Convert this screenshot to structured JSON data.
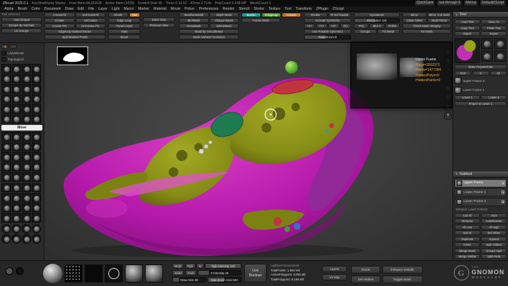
{
  "colors": {
    "teal": "#13a28f",
    "green": "#4a9e2a",
    "orange": "#c4761e",
    "magenta": "#bf1bb3",
    "olive": "#8b9318",
    "value_orange": "#f0a640"
  },
  "titlebar": {
    "app_title": "ZBrush 2025.0.1",
    "stats": [
      "KeyShotHome Master",
      "Free Mem:44,002GB",
      "Active Mem:(1035)",
      "Scratch Disk 45",
      "Timer:0:10.52",
      "ATime 2.714s",
      "PolyCount 6.198 MP",
      "MeshCount 3"
    ],
    "right_items": [
      "QuickSave",
      "see-through 0",
      "Menus",
      "DefaultZScript"
    ]
  },
  "menubar": {
    "items": [
      "Alpha",
      "Brush",
      "Color",
      "Document",
      "Draw",
      "Edit",
      "File",
      "Layer",
      "Light",
      "Macro",
      "Marker",
      "Material",
      "Movie",
      "Picker",
      "Preferences",
      "Render",
      "Stencil",
      "Stroke",
      "Texture",
      "Tool",
      "Transform",
      "ZPlugin",
      "ZScript"
    ]
  },
  "shelf": {
    "status": "Tool selected",
    "groups_col": [
      "Auto Groups",
      "Groups By Normals",
      "Uv Groups"
    ],
    "crease_pairs": [
      [
        "CreaseAll",
        "UnCreaseAll"
      ],
      [
        "Crease",
        "UnCrease"
      ],
      [
        "Crease PG",
        "UnCrease PG"
      ]
    ],
    "crease_wide": [
      "Edgeloop Masked Border",
      "Split Masked Points"
    ],
    "divide_label": "Divide",
    "smt_label": "Smt",
    "geom_col": [
      "Edge Loop",
      "Panel Loops",
      "Inset",
      "Bevel"
    ],
    "view_col": [
      "Store View",
      "Previous View"
    ],
    "mask_pairs": [
      [
        "BackfaceMask",
        "Depth Mask"
      ],
      [
        "BlurMask",
        "SharpenMask"
      ],
      [
        "GrowMask",
        "ShrinkMask"
      ]
    ],
    "mask_wide": [
      "Mask By Smoothness",
      "Mask Ambient Occlusion"
    ],
    "frame_label": "Frame Mesh",
    "frame_toggles": [
      {
        "label": "Border",
        "color": "#13a28f"
      },
      {
        "label": "Polygroup",
        "color": "#4a9e2a"
      },
      {
        "label": "Crease",
        "color": "#c4761e"
      }
    ],
    "sym": {
      "row1": [
        "Double",
        "Pt Sel Double"
      ],
      "activate": "Activate Symmetry",
      "axes": [
        ">X<",
        ">Y<",
        ">Z<",
        "(R)"
      ],
      "posable": "Use Posable Symmetry",
      "radial": "RadialCount 8"
    },
    "dynamesh": {
      "label": "DynaMesh",
      "resolution": "Resolution 128",
      "row1": [
        "Proj",
        "Blur 2",
        "Polish"
      ],
      "row2": [
        "Groups",
        "Fix Mesh"
      ]
    },
    "repair_pairs": [
      [
        "Mirror",
        "Mirror And Weld"
      ],
      [
        "Close Holes",
        "Weld Points"
      ]
    ],
    "repair_wide": [
      "Check Mesh Integrity",
      "Fix Mesh"
    ]
  },
  "left_tray": {
    "toggles": [
      {
        "label": "LazyMouse"
      },
      {
        "label": "Topological"
      }
    ],
    "selected_brush": "Move",
    "grid1": [
      "",
      "",
      "",
      "",
      "",
      "",
      "",
      "",
      "",
      "",
      "",
      "",
      "",
      "",
      "",
      "",
      "",
      "",
      "",
      "",
      "",
      "",
      "",
      ""
    ],
    "grid2": [
      "",
      "",
      "",
      "",
      "",
      "",
      "",
      "",
      "",
      "",
      "",
      "",
      "",
      "",
      "",
      "",
      "",
      "",
      "",
      ""
    ],
    "grid3": [
      "",
      "",
      "",
      "",
      "",
      "",
      "",
      "",
      "",
      "",
      "",
      "",
      "",
      "",
      "",
      ""
    ],
    "grid4": [
      "",
      "",
      "",
      "",
      "",
      "",
      "",
      ""
    ]
  },
  "popup": {
    "name": "Upper Frame",
    "lines": [
      "Polys=2932373",
      "Points=1477394",
      "HiddenPolys=0",
      "HiddenPoints=0"
    ]
  },
  "right_shelf": {
    "icons": [
      {
        "name": "frame-icon",
        "glyph": "◎"
      },
      {
        "name": "zoom-icon",
        "glyph": "⊕"
      },
      {
        "name": "scroll-icon",
        "glyph": "+"
      },
      {
        "name": "flip-icon",
        "glyph": "↕"
      },
      {
        "name": "polyframe-icon",
        "glyph": "▦"
      },
      {
        "name": "grid-icon",
        "glyph": "▤"
      },
      {
        "name": "transparency-icon",
        "glyph": "◐"
      },
      {
        "name": "solo-icon",
        "glyph": "●"
      }
    ]
  },
  "tool_palette": {
    "header": "Tool",
    "file_rows": [
      [
        "Load Tool",
        "Save As"
      ],
      [
        "Copy Tool",
        "Paste Tool"
      ],
      [
        "Import",
        "Export"
      ]
    ],
    "make_polymesh": "Make PolyMesh3D",
    "goz_row": [
      "GoZ",
      "S",
      "All"
    ],
    "recent_labels": [
      {
        "label": "Upper Frame 3"
      },
      {
        "label": "Lower Frame 1"
      }
    ],
    "custom_pair": [
      "Lower 1",
      "Lower 3"
    ],
    "custom_wide": "Project to Lower 1"
  },
  "subtool": {
    "header": "Subtool",
    "items": [
      {
        "name": "Upper Frame",
        "selected": true
      },
      {
        "name": "Lower Frame 1",
        "selected": false
      },
      {
        "name": "Lower Frame 2",
        "selected": false
      }
    ],
    "caption": "Merged: Lower Frame1",
    "button_rows": [
      [
        "List All",
        "Auto"
      ],
      [
        "Rename",
        "AutoReorder"
      ],
      [
        "All Low",
        "All High"
      ],
      [
        "Del All",
        "Del Other"
      ],
      [
        "Duplicate",
        "Append"
      ],
      [
        "Insert",
        "Split Hidden"
      ],
      [
        "Merge Down",
        "Groups Split"
      ],
      [
        "Merge Visible",
        "Split Parts"
      ]
    ]
  },
  "bottom": {
    "draw_buttons1": [
      "Mrgb",
      "Rgb",
      "M"
    ],
    "draw_buttons2": [
      "Zadd",
      "Zsub"
    ],
    "sliders": [
      "Rgb Intensity 100",
      "Z Intensity 25",
      "Draw Size 90",
      "Max Brush Size 500"
    ],
    "live_boolean": "Live Boolean",
    "stats": [
      "Lightbox>Documents",
      "TotalPoints: 1.502 Mil",
      "ActivePolygons: 3.093 Mil",
      "TotalPolygons: 6.198 Mil"
    ],
    "pair": [
      "Layers",
      "UV Map"
    ],
    "actions": [
      "Divide",
      "Enhance Details",
      "Del Hidden",
      "Toggle Mask"
    ],
    "thumbs": [
      {
        "name": "material-sphere-thumb"
      },
      {
        "name": "stroke-dots-thumb"
      },
      {
        "name": "alpha-off-thumb"
      },
      {
        "name": "stroke-circle-thumb"
      },
      {
        "name": "sphere-thumb-1"
      },
      {
        "name": "sphere-thumb-2"
      }
    ],
    "logo": {
      "the": "THE",
      "gnomon": "GNOMON",
      "workshop": "WORKSHOP",
      "g": "G"
    }
  }
}
